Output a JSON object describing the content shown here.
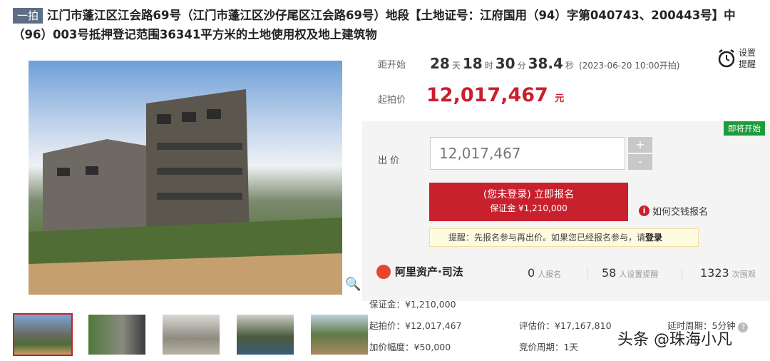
{
  "title": {
    "tag": "一拍",
    "text": "江门市蓬江区江会路69号（江门市蓬江区沙仔尾区江会路69号）地段【土地证号：江府国用（94）字第040743、200443号】中（96）003号抵押登记范围36341平方米的土地使用权及地上建筑物"
  },
  "countdown": {
    "label": "距开始",
    "days": "28",
    "days_unit": "天",
    "hours": "18",
    "hours_unit": "时",
    "minutes": "30",
    "minutes_unit": "分",
    "seconds": "38.4",
    "seconds_unit": "秒",
    "start_note": "(2023-06-20 10:00开拍)"
  },
  "alarm": {
    "label": "设置提醒",
    "icon": "alarm-clock-icon"
  },
  "start_price": {
    "label": "起拍价",
    "value": "12,017,467",
    "unit": "元"
  },
  "bid": {
    "badge": "即将开始",
    "label": "出 价",
    "input_value": "12,017,467",
    "plus": "+",
    "minus": "-",
    "signup_line1": "(您未登录) 立即报名",
    "signup_line2": "保证金 ¥1,210,000",
    "howto": "如何交钱报名",
    "reminder_text": "提醒：先报名参与再出价。如果您已经报名参与，请",
    "reminder_link": "登录"
  },
  "stats": {
    "logo_text": "阿里资产·司法",
    "signups": "0",
    "signups_label": "人报名",
    "reminders": "58",
    "reminders_label": "人设置提醒",
    "views": "1323",
    "views_label": "次围观"
  },
  "info": {
    "deposit": "保证金：¥1,210,000",
    "start_price": "起拍价：¥12,017,467",
    "appraisal": "评估价：¥17,167,810",
    "delay": "延时周期：5分钟",
    "increment": "加价幅度：¥50,000",
    "cycle": "竞价周期：1天"
  },
  "watermark": "头条 @珠海小凡",
  "colors": {
    "accent": "#c9202e",
    "badge": "#1e9c3b",
    "tag": "#5c6f86"
  }
}
